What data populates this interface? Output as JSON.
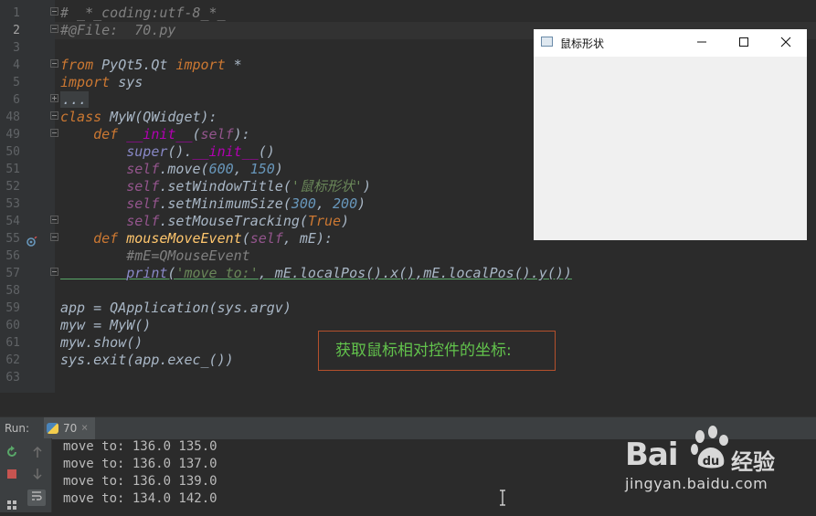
{
  "editor": {
    "line_numbers": [
      "1",
      "2",
      "3",
      "4",
      "5",
      "6",
      "48",
      "49",
      "50",
      "51",
      "52",
      "53",
      "54",
      "55",
      "56",
      "57",
      "58",
      "59",
      "60",
      "61",
      "62",
      "63"
    ],
    "lines": [
      {
        "t": "# _*_coding:utf-8_*_"
      },
      {
        "t": "#@File:  70.py"
      },
      {
        "t": ""
      },
      {
        "t": "from PyQt5.Qt import *"
      },
      {
        "t": "import sys"
      },
      {
        "t": "..."
      },
      {
        "t": "class MyW(QWidget):"
      },
      {
        "t": "    def __init__(self):"
      },
      {
        "t": "        super().__init__()"
      },
      {
        "t": "        self.move(600, 150)"
      },
      {
        "t": "        self.setWindowTitle('鼠标形状')"
      },
      {
        "t": "        self.setMinimumSize(300, 200)"
      },
      {
        "t": "        self.setMouseTracking(True)"
      },
      {
        "t": "    def mouseMoveEvent(self, mE):"
      },
      {
        "t": "        #mE=QMouseEvent"
      },
      {
        "t": "        print('move to:', mE.localPos().x(),mE.localPos().y())"
      },
      {
        "t": ""
      },
      {
        "t": "app = QApplication(sys.argv)"
      },
      {
        "t": "myw = MyW()"
      },
      {
        "t": "myw.show()"
      },
      {
        "t": "sys.exit(app.exec_())"
      },
      {
        "t": ""
      }
    ]
  },
  "app_window": {
    "title": "鼠标形状",
    "minimize": "—",
    "maximize": "☐",
    "close": "✕"
  },
  "annotation": "获取鼠标相对控件的坐标:",
  "run_panel": {
    "label": "Run:",
    "tab_name": "70",
    "tab_close": "×",
    "output": [
      "move to: 136.0 135.0",
      "move to: 136.0 137.0",
      "move to: 136.0 139.0",
      "move to: 134.0 142.0"
    ]
  },
  "watermark": {
    "bai": "Bai",
    "du": "du",
    "cn": "经验",
    "url": "jingyan.baidu.com"
  },
  "colors": {
    "background": "#2b2b2b",
    "gutter": "#313335",
    "keyword": "#cc7832",
    "string": "#6a8759",
    "number": "#6897bb",
    "annotation_border": "#b5502c",
    "annotation_text": "#62c34c"
  },
  "icons": [
    "rerun-icon",
    "stop-icon",
    "up-arrow-icon",
    "down-arrow-icon",
    "soft-wrap-icon",
    "python-file-icon",
    "breakpoint-override-icon",
    "window-app-icon",
    "text-cursor-icon"
  ]
}
